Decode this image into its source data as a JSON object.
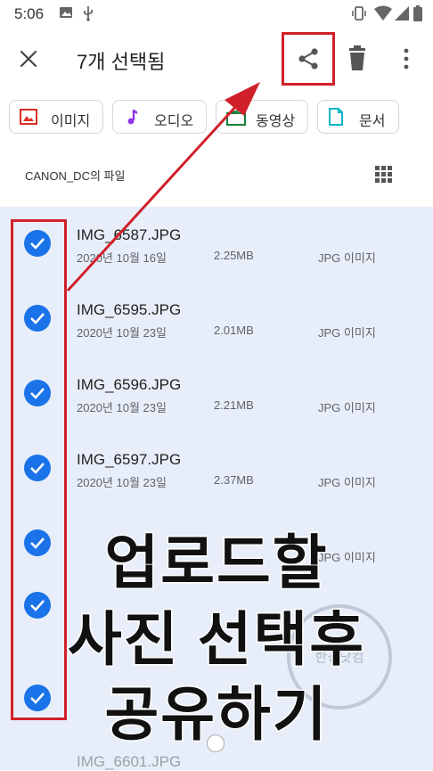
{
  "status_bar": {
    "time": "5:06"
  },
  "app_bar": {
    "title": "7개 선택됨"
  },
  "chips": [
    {
      "label": "이미지",
      "icon": "image-icon",
      "color": "#d93025"
    },
    {
      "label": "오디오",
      "icon": "music-note-icon",
      "color": "#9334e6"
    },
    {
      "label": "동영상",
      "icon": "video-icon",
      "color": "#188038"
    },
    {
      "label": "문서",
      "icon": "document-icon",
      "color": "#12b5cb"
    }
  ],
  "folder_label": "CANON_DC의 파일",
  "files": [
    {
      "name": "IMG_6587.JPG",
      "date": "2020년 10월 16일",
      "size": "2.25MB",
      "type": "JPG 이미지",
      "selected": true
    },
    {
      "name": "IMG_6595.JPG",
      "date": "2020년 10월 23일",
      "size": "2.01MB",
      "type": "JPG 이미지",
      "selected": true
    },
    {
      "name": "IMG_6596.JPG",
      "date": "2020년 10월 23일",
      "size": "2.21MB",
      "type": "JPG 이미지",
      "selected": true
    },
    {
      "name": "IMG_6597.JPG",
      "date": "2020년 10월 23일",
      "size": "2.37MB",
      "type": "JPG 이미지",
      "selected": true
    },
    {
      "name": "",
      "date": "",
      "size": "",
      "type": "JPG 이미지",
      "selected": true
    },
    {
      "name": "",
      "date": "",
      "size": "",
      "type": "",
      "selected": true
    },
    {
      "name": "",
      "date": "",
      "size": "",
      "type": "",
      "selected": true
    }
  ],
  "partial_file": "IMG_6601.JPG",
  "overlay_caption": [
    "업로드할",
    "사진 선택후",
    "공유하기"
  ],
  "watermark": "한경닷컴",
  "colors": {
    "accent": "#1a73e8",
    "selection_bg": "#e8eef9",
    "annotation": "#d0202a"
  }
}
